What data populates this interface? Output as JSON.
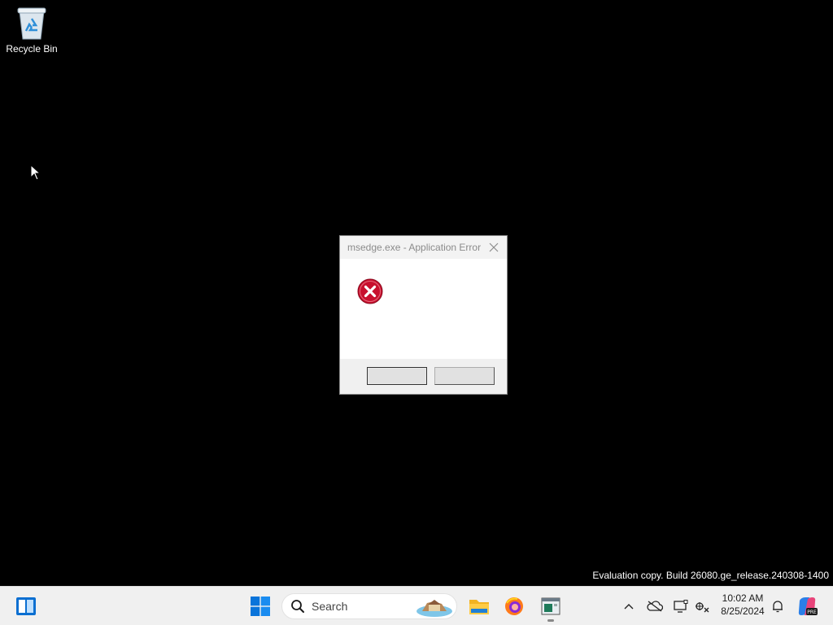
{
  "desktop": {
    "icons": [
      {
        "label": "Recycle Bin",
        "icon": "recycle-bin-icon"
      }
    ],
    "watermark": "Evaluation copy. Build 26080.ge_release.240308-1400"
  },
  "dialog": {
    "title": "msedge.exe - Application Error",
    "icon": "error-icon",
    "ok_label": "",
    "cancel_label": ""
  },
  "taskbar": {
    "search_placeholder": "Search",
    "pinned": [
      "widgets-icon",
      "start-icon",
      "file-explorer-icon",
      "firefox-icon",
      "app-window-icon"
    ],
    "tray": [
      "chevron-up-icon",
      "onedrive-icon",
      "display-icon",
      "network-icon",
      "bell-icon",
      "copilot-icon"
    ],
    "clock": {
      "time": "10:02 AM",
      "date": "8/25/2024"
    }
  },
  "colors": {
    "desktop_bg": "#000000",
    "taskbar_bg": "#f0f0f0",
    "start_blue": "#0067c0",
    "error_red": "#c8102e"
  }
}
